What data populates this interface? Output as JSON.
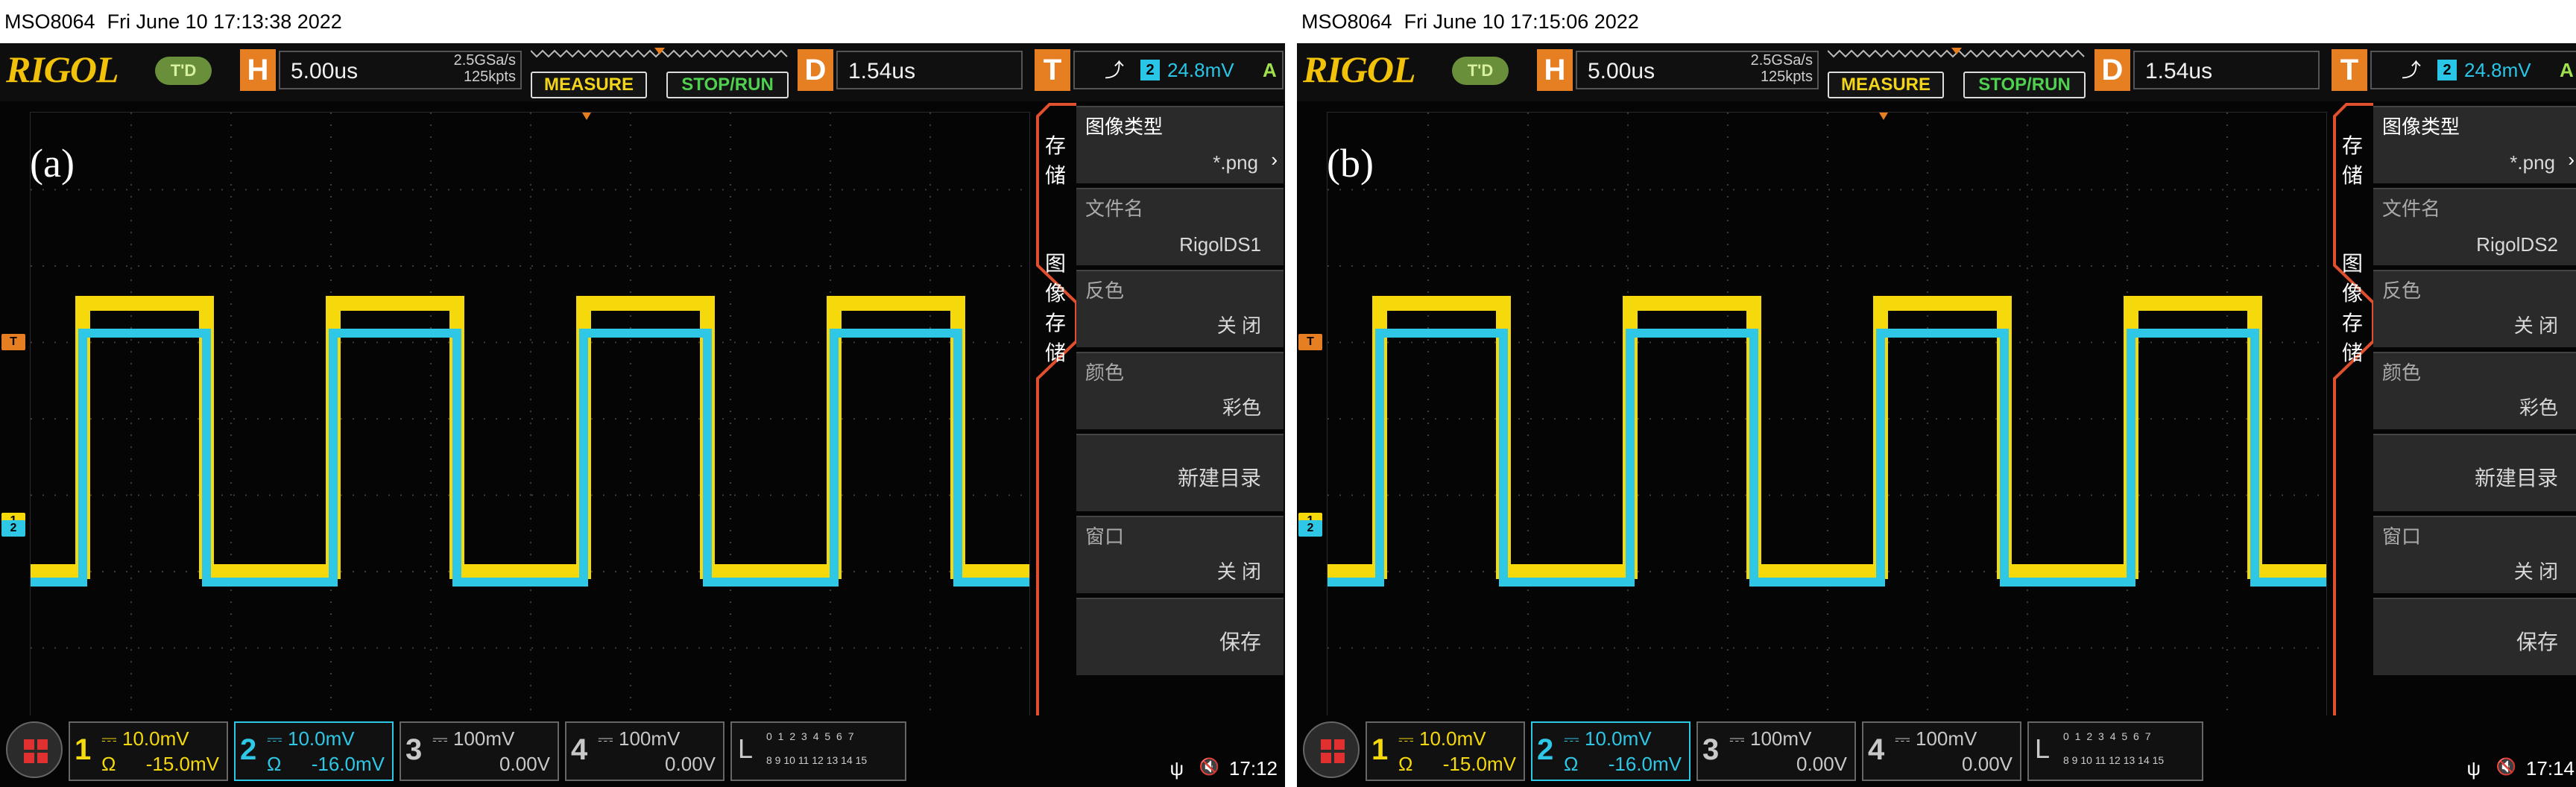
{
  "colors": {
    "ch1": "#f5d90a",
    "ch2": "#2ec8e6",
    "accent_orange": "#e67e22",
    "menu_outline": "#e0502e"
  },
  "icons": {
    "usb": "usb-icon",
    "speaker": "speaker-muted-icon",
    "home": "home-grid-icon",
    "trigger_edge": "rising-edge-icon"
  },
  "panels": [
    {
      "tag": "(a)",
      "status": {
        "model": "MSO8064",
        "datetime": "Fri June 10 17:13:38 2022"
      },
      "top": {
        "logo": "RIGOL",
        "td": "T'D",
        "h_letter": "H",
        "h_value": "5.00us",
        "sample_rate": "2.5GSa/s",
        "points": "125kpts",
        "measure": "MEASURE",
        "stoprun": "STOP/RUN",
        "d_letter": "D",
        "d_value": "1.54us",
        "t_letter": "T",
        "trig_source": "2",
        "trig_level": "24.8mV",
        "trig_mode": "A"
      },
      "side_tabs": [
        "存",
        "储",
        "图",
        "像",
        "存",
        "储"
      ],
      "menu": [
        {
          "label": "图像类型",
          "value": ".png",
          "prefix": "*"
        },
        {
          "label": "文件名",
          "value": "RigolDS1"
        },
        {
          "label": "反色",
          "value": "关 闭"
        },
        {
          "label": "颜色",
          "value": "彩色"
        },
        {
          "label": "",
          "value": "新建目录"
        },
        {
          "label": "窗口",
          "value": "关 闭"
        },
        {
          "label": "",
          "value": "保存"
        }
      ],
      "channels": [
        {
          "num": "1",
          "scale": "10.0mV",
          "imp": "Ω",
          "offset": "-15.0mV"
        },
        {
          "num": "2",
          "scale": "10.0mV",
          "imp": "Ω",
          "offset": "-16.0mV"
        },
        {
          "num": "3",
          "scale": "100mV",
          "offset": "0.00V"
        },
        {
          "num": "4",
          "scale": "100mV",
          "offset": "0.00V"
        }
      ],
      "la": {
        "letter": "L",
        "row1": "0 1 2 3  4 5 6 7",
        "row2": "8 9 10 11 12 13 14 15"
      },
      "time": "17:12"
    },
    {
      "tag": "(b)",
      "status": {
        "model": "MSO8064",
        "datetime": "Fri June 10 17:15:06 2022"
      },
      "top": {
        "logo": "RIGOL",
        "td": "T'D",
        "h_letter": "H",
        "h_value": "5.00us",
        "sample_rate": "2.5GSa/s",
        "points": "125kpts",
        "measure": "MEASURE",
        "stoprun": "STOP/RUN",
        "d_letter": "D",
        "d_value": "1.54us",
        "t_letter": "T",
        "trig_source": "2",
        "trig_level": "24.8mV",
        "trig_mode": "A"
      },
      "side_tabs": [
        "存",
        "储",
        "图",
        "像",
        "存",
        "储"
      ],
      "menu": [
        {
          "label": "图像类型",
          "value": ".png",
          "prefix": "*"
        },
        {
          "label": "文件名",
          "value": "RigolDS2"
        },
        {
          "label": "反色",
          "value": "关 闭"
        },
        {
          "label": "颜色",
          "value": "彩色"
        },
        {
          "label": "",
          "value": "新建目录"
        },
        {
          "label": "窗口",
          "value": "关 闭"
        },
        {
          "label": "",
          "value": "保存"
        }
      ],
      "channels": [
        {
          "num": "1",
          "scale": "10.0mV",
          "imp": "Ω",
          "offset": "-15.0mV"
        },
        {
          "num": "2",
          "scale": "10.0mV",
          "imp": "Ω",
          "offset": "-16.0mV"
        },
        {
          "num": "3",
          "scale": "100mV",
          "offset": "0.00V"
        },
        {
          "num": "4",
          "scale": "100mV",
          "offset": "0.00V"
        }
      ],
      "la": {
        "letter": "L",
        "row1": "0 1 2 3  4 5 6 7",
        "row2": "8 9 10 11 12 13 14 15"
      },
      "time": "17:14"
    }
  ]
}
